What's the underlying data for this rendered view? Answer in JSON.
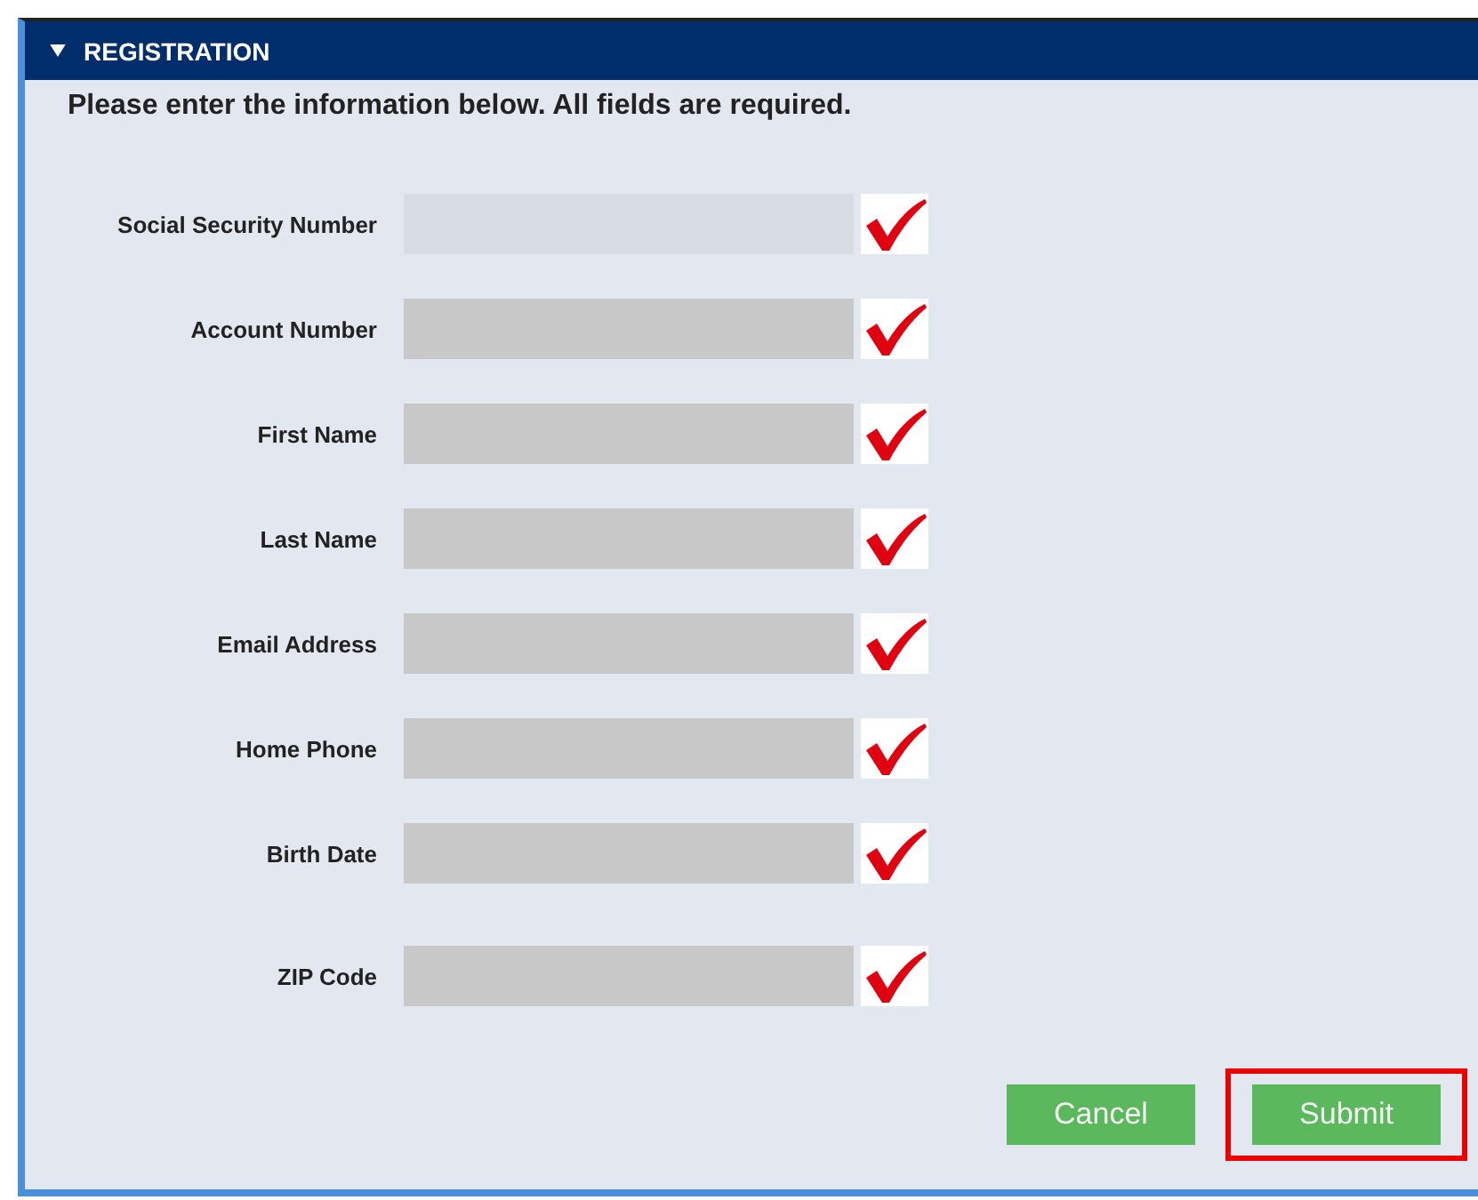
{
  "panel": {
    "title": "REGISTRATION",
    "expanded": true
  },
  "instructions": "Please enter the information below. All fields are required.",
  "fields": [
    {
      "label": "Social Security Number",
      "focused": true,
      "valid": true
    },
    {
      "label": "Account Number",
      "focused": false,
      "valid": true
    },
    {
      "label": "First Name",
      "focused": false,
      "valid": true
    },
    {
      "label": "Last Name",
      "focused": false,
      "valid": true
    },
    {
      "label": "Email Address",
      "focused": false,
      "valid": true
    },
    {
      "label": "Home Phone",
      "focused": false,
      "valid": true
    },
    {
      "label": "Birth Date",
      "focused": false,
      "valid": true
    },
    {
      "label": "ZIP Code",
      "focused": false,
      "valid": true
    }
  ],
  "buttons": [
    {
      "label": "Cancel",
      "highlighted": false
    },
    {
      "label": "Submit",
      "highlighted": true
    }
  ]
}
